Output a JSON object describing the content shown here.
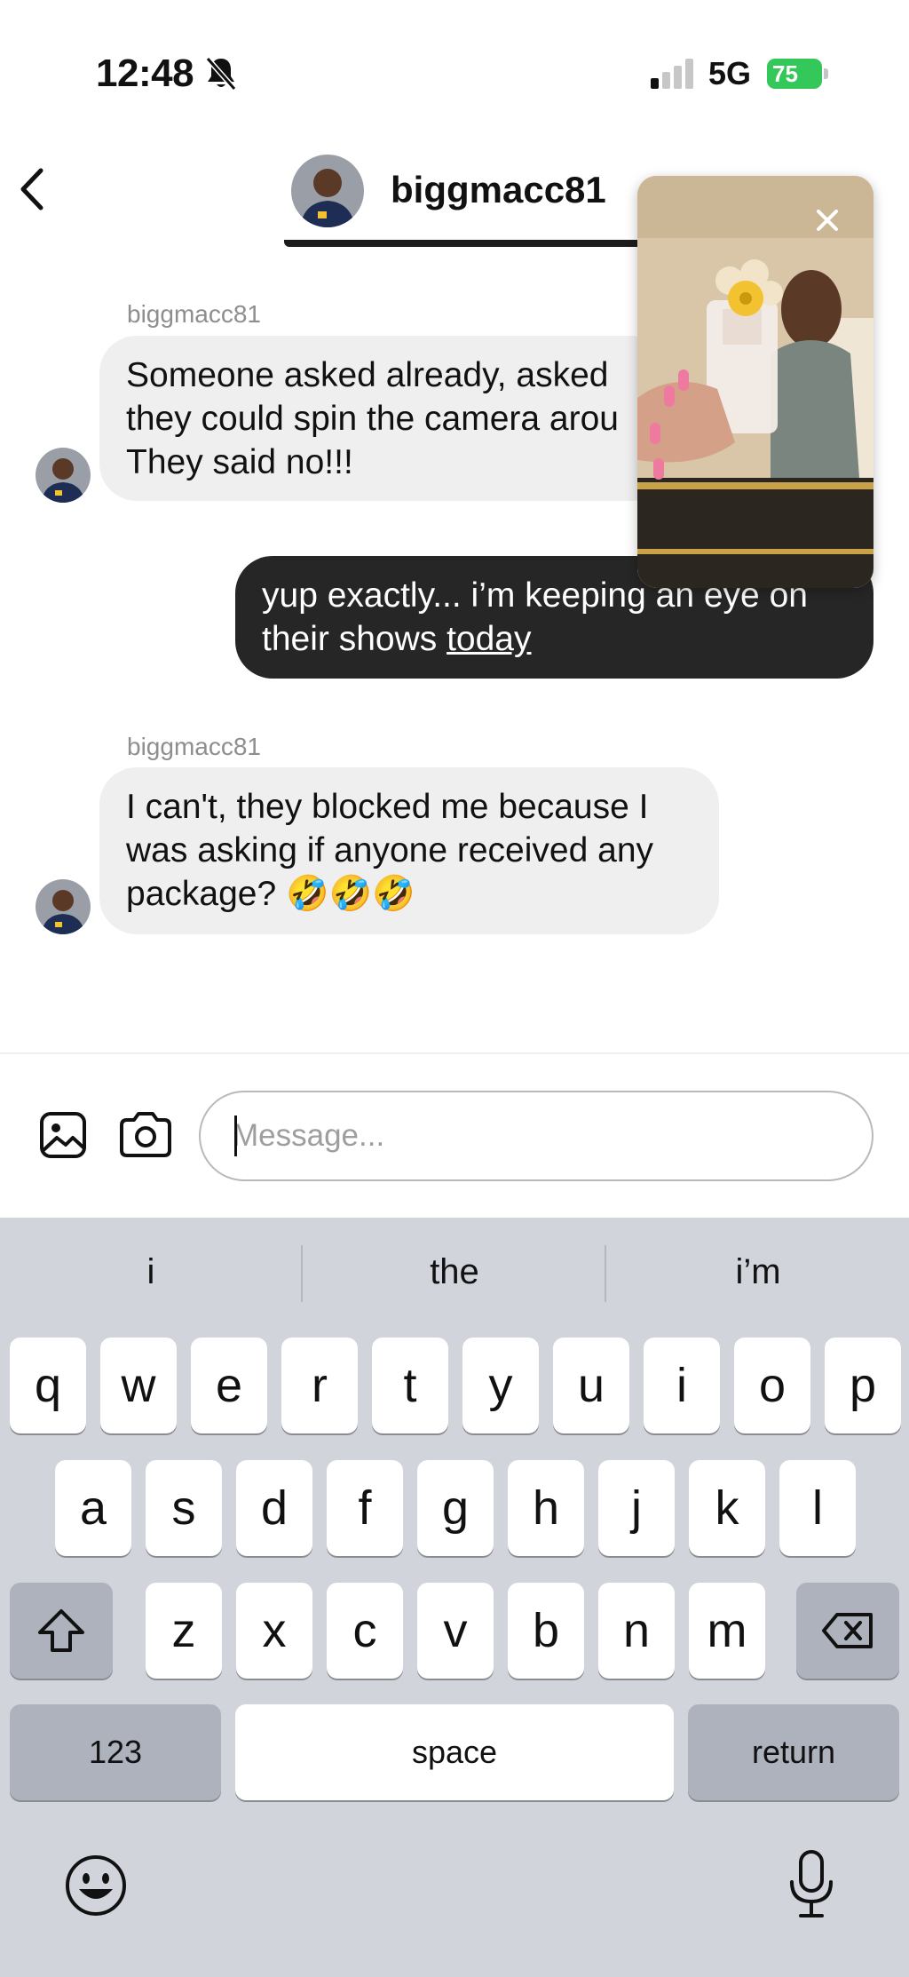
{
  "status_bar": {
    "time": "12:48",
    "network": "5G",
    "battery": "75"
  },
  "header": {
    "username": "biggmacc81"
  },
  "messages": [
    {
      "sender": "biggmacc81",
      "lines": [
        "Someone asked already, asked",
        "they could spin the camera arou",
        "They said no!!!"
      ]
    },
    {
      "sender": "me",
      "line1": "yup exactly... i’m keeping an eye on",
      "line2_prefix": "their shows ",
      "line2_link": "today"
    },
    {
      "sender": "biggmacc81",
      "lines": [
        "I can't, they blocked me because I",
        "was asking if anyone received any",
        "package? 🤣🤣🤣"
      ]
    }
  ],
  "composer": {
    "placeholder": "Message..."
  },
  "keyboard": {
    "suggestions": [
      "i",
      "the",
      "i’m"
    ],
    "row1": [
      "q",
      "w",
      "e",
      "r",
      "t",
      "y",
      "u",
      "i",
      "o",
      "p"
    ],
    "row2": [
      "a",
      "s",
      "d",
      "f",
      "g",
      "h",
      "j",
      "k",
      "l"
    ],
    "row3": [
      "z",
      "x",
      "c",
      "v",
      "b",
      "n",
      "m"
    ],
    "numbers_key": "123",
    "space_key": "space",
    "return_key": "return"
  },
  "colors": {
    "battery": "#34c759",
    "incoming_bubble": "#efefef",
    "outgoing_bubble": "#262626",
    "keyboard_bg": "#d1d4db"
  }
}
